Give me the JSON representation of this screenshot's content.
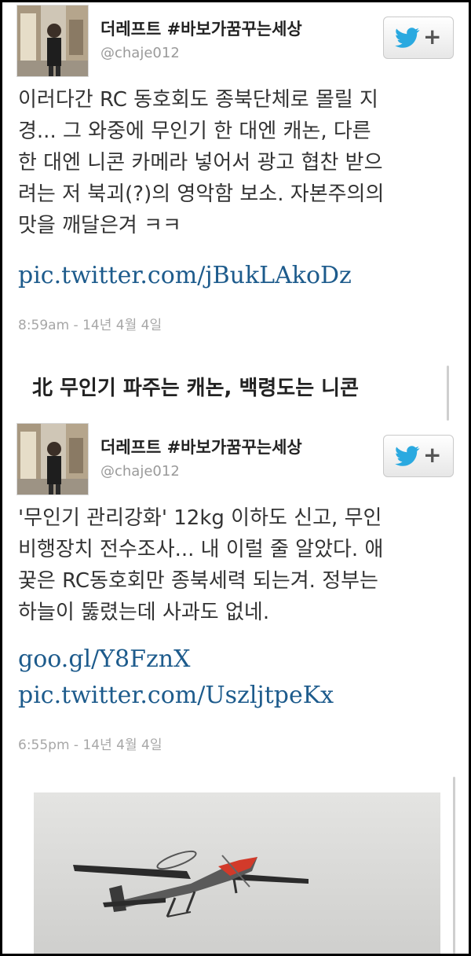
{
  "tweets": [
    {
      "display_name": "더레프트 #바보가꿈꾸는세상",
      "handle": "@chaje012",
      "text_lines": [
        "이러다간 RC 동호회도 종북단체로 몰릴 지",
        "경... 그 와중에 무인기 한 대엔 캐논, 다른",
        "한 대엔 니콘 카메라 넣어서 광고 협찬 받으",
        "려는 저 북괴(?)의 영악함 보소. 자본주의의",
        "맛을 깨달은겨 ㅋㅋ"
      ],
      "links": [
        "pic.twitter.com/jBukLAkoDz"
      ],
      "timestamp": "8:59am - 14년 4월 4일"
    },
    {
      "display_name": "더레프트 #바보가꿈꾸는세상",
      "handle": "@chaje012",
      "text_lines": [
        "'무인기 관리강화' 12kg 이하도 신고, 무인",
        "비행장치 전수조사... 내 이럴 줄 알았다. 애",
        "꿎은 RC동호회만 종북세력 되는겨. 정부는",
        "하늘이 뚫렸는데 사과도 없네."
      ],
      "links": [
        "goo.gl/Y8FznX",
        "pic.twitter.com/UszljtpeKx"
      ],
      "timestamp": "6:55pm - 14년 4월 4일"
    }
  ],
  "headline": "北 무인기 파주는 캐논, 백령도는 니콘",
  "follow_button": {
    "icon": "twitter-bird-icon",
    "plus": "+"
  },
  "colors": {
    "link": "#1d5b8c",
    "twitter_blue": "#2aa9e0",
    "text": "#333333",
    "muted": "#a7a7a7"
  }
}
